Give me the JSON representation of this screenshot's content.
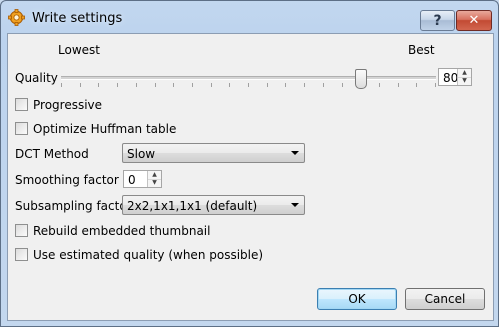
{
  "window": {
    "title": "Write settings"
  },
  "titlebar": {
    "help_symbol": "?",
    "close_symbol": "✕"
  },
  "quality": {
    "label": "Quality",
    "lowest_label": "Lowest",
    "best_label": "Best",
    "value": "80",
    "slider_fraction": 0.8
  },
  "options": {
    "progressive": {
      "label": "Progressive",
      "checked": false
    },
    "optimize_huffman": {
      "label": "Optimize Huffman table",
      "checked": false
    },
    "rebuild_thumbnail": {
      "label": "Rebuild embedded thumbnail",
      "checked": false
    },
    "estimated_quality": {
      "label": "Use estimated quality (when possible)",
      "checked": false
    }
  },
  "dct": {
    "label": "DCT Method",
    "value": "Slow"
  },
  "smoothing": {
    "label": "Smoothing factor",
    "value": "0"
  },
  "subsampling": {
    "label": "Subsampling factor",
    "value": "2x2,1x1,1x1 (default)"
  },
  "buttons": {
    "ok": "OK",
    "cancel": "Cancel"
  },
  "icons": {
    "app": "gear-icon",
    "help": "help-icon",
    "close": "close-icon"
  },
  "colors": {
    "title_gradient": "#bcd3ee",
    "client_bg": "#f0f0f0",
    "close_button": "#c24a33",
    "ok_border": "#3c7fb1"
  }
}
